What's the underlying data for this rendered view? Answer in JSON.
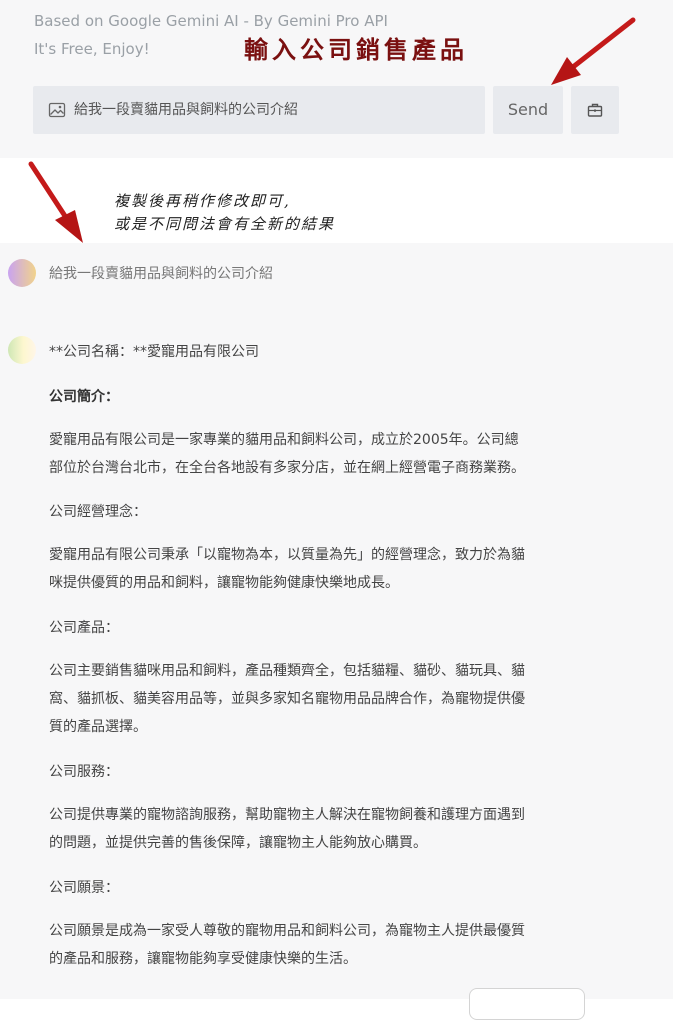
{
  "header": {
    "subtitle_line1": "Based on Google Gemini AI - By Gemini Pro API",
    "subtitle_line2": "It's Free, Enjoy!"
  },
  "annotations": {
    "title": "輸入公司銷售產品",
    "note_line1": "複製後再稍作修改即可,",
    "note_line2": "或是不同問法會有全新的結果"
  },
  "input": {
    "value": "給我一段賣貓用品與飼料的公司介紹",
    "icon": "image-icon"
  },
  "buttons": {
    "send_label": "Send",
    "clear_icon": "briefcase-icon"
  },
  "chat": {
    "user_message": "給我一段賣貓用品與飼料的公司介紹",
    "response_lines": [
      "**公司名稱：**愛寵用品有限公司",
      "公司簡介：",
      "愛寵用品有限公司是一家專業的貓用品和飼料公司，成立於2005年。公司總",
      "部位於台灣台北市，在全台各地設有多家分店，並在網上經營電子商務業務。",
      "公司經營理念：",
      "愛寵用品有限公司秉承「以寵物為本，以質量為先」的經營理念，致力於為貓",
      "咪提供優質的用品和飼料，讓寵物能夠健康快樂地成長。",
      "公司產品：",
      "公司主要銷售貓咪用品和飼料，產品種類齊全，包括貓糧、貓砂、貓玩具、貓",
      "窩、貓抓板、貓美容用品等，並與多家知名寵物用品品牌合作，為寵物提供優",
      "質的產品選擇。",
      "公司服務：",
      "公司提供專業的寵物諮詢服務，幫助寵物主人解決在寵物飼養和護理方面遇到",
      "的問題，並提供完善的售後保障，讓寵物主人能夠放心購買。",
      "公司願景：",
      "公司願景是成為一家受人尊敬的寵物用品和飼料公司，為寵物主人提供最優質",
      "的產品和服務，讓寵物能夠享受健康快樂的生活。"
    ]
  },
  "colors": {
    "panel_bg": "#f7f7f8",
    "input_bg": "#e8eaee",
    "annotation_red": "#7a1010",
    "arrow_red": "#c41a1a"
  }
}
